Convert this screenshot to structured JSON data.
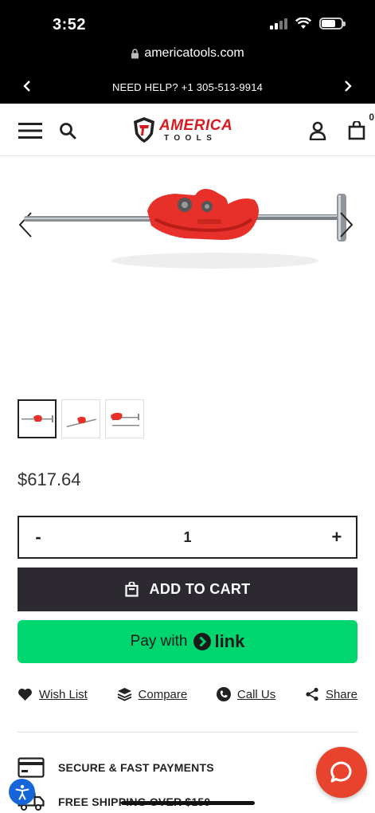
{
  "status_bar": {
    "time": "3:52"
  },
  "browser": {
    "url": "americatools.com"
  },
  "announcement": {
    "text": "NEED HELP? +1 305-513-9914"
  },
  "header": {
    "logo_top": "AMERICA",
    "logo_bottom": "TOOLS",
    "cart_count": "0"
  },
  "product": {
    "price": "$617.64",
    "quantity": "1",
    "qty_minus": "-",
    "qty_plus": "+",
    "add_to_cart_label": "ADD TO CART",
    "pay_with_label": "Pay with",
    "pay_brand": "link",
    "accent_color": "#e8302a"
  },
  "actions": [
    {
      "label": "Wish List",
      "icon": "heart-icon"
    },
    {
      "label": "Compare",
      "icon": "layers-icon"
    },
    {
      "label": "Call Us",
      "icon": "phone-icon"
    },
    {
      "label": "Share",
      "icon": "share-icon"
    }
  ],
  "features": [
    {
      "label": "SECURE & FAST PAYMENTS",
      "icon": "credit-card-icon"
    },
    {
      "label": "FREE SHIPPING OVER $150",
      "icon": "truck-icon"
    }
  ],
  "colors": {
    "add_to_cart_bg": "#2c2a30",
    "link_pay_bg": "#00d66f",
    "chat_bg": "#e8432d",
    "accessibility_bg": "#1565d8"
  }
}
